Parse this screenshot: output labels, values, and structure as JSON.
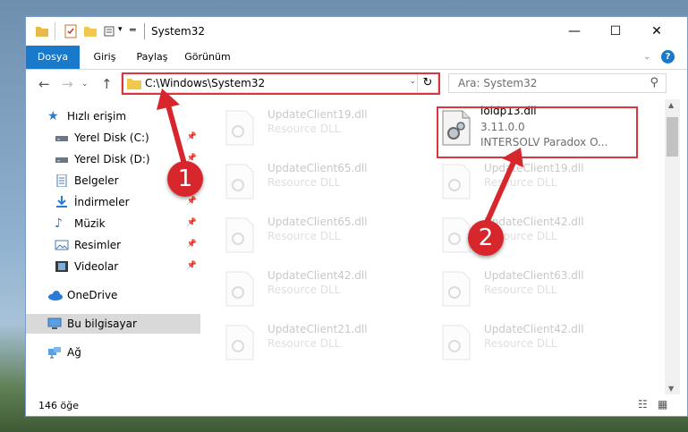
{
  "window": {
    "title": "System32",
    "controls": {
      "minimize": "—",
      "maximize": "☐",
      "close": "✕"
    }
  },
  "ribbon": {
    "tabs": [
      "Dosya",
      "Giriş",
      "Paylaş",
      "Görünüm"
    ],
    "help": "?"
  },
  "address": {
    "path": "C:\\Windows\\System32",
    "search_placeholder": "Ara: System32"
  },
  "sidebar": {
    "quick_access": "Hızlı erişim",
    "items": [
      {
        "label": "Yerel Disk (C:)",
        "icon": "drive-icon",
        "pinned": true
      },
      {
        "label": "Yerel Disk (D:)",
        "icon": "drive-icon",
        "pinned": true
      },
      {
        "label": "Belgeler",
        "icon": "documents-icon",
        "pinned": true
      },
      {
        "label": "İndirmeler",
        "icon": "downloads-icon",
        "pinned": true
      },
      {
        "label": "Müzik",
        "icon": "music-icon",
        "pinned": true
      },
      {
        "label": "Resimler",
        "icon": "pictures-icon",
        "pinned": true
      },
      {
        "label": "Videolar",
        "icon": "videos-icon",
        "pinned": true
      }
    ],
    "onedrive": "OneDrive",
    "this_pc": "Bu bilgisayar",
    "network": "Ağ"
  },
  "files": {
    "highlighted": {
      "name": "loidp13.dll",
      "version": "3.11.0.0",
      "description": "INTERSOLV Paradox O..."
    },
    "left_column": [
      {
        "name": "UpdateClient19.dll",
        "type": "Resource DLL"
      },
      {
        "name": "UpdateClient65.dll",
        "type": "Resource DLL"
      },
      {
        "name": "UpdateClient65.dll",
        "type": "Resource DLL"
      },
      {
        "name": "UpdateClient42.dll",
        "type": "Resource DLL"
      },
      {
        "name": "UpdateClient21.dll",
        "type": "Resource DLL"
      }
    ],
    "right_column": [
      {
        "name": "UpdateClient19.dll",
        "type": "Resource DLL"
      },
      {
        "name": "UpdateClient42.dll",
        "type": "Resource DLL"
      },
      {
        "name": "UpdateClient63.dll",
        "type": "Resource DLL"
      },
      {
        "name": "UpdateClient42.dll",
        "type": "Resource DLL"
      }
    ]
  },
  "status": {
    "count": "146 öğe"
  },
  "annotations": {
    "step1": "1",
    "step2": "2"
  },
  "colors": {
    "accent": "#1979ca",
    "annotation": "#d7262c",
    "selection": "#d9d9d9"
  }
}
